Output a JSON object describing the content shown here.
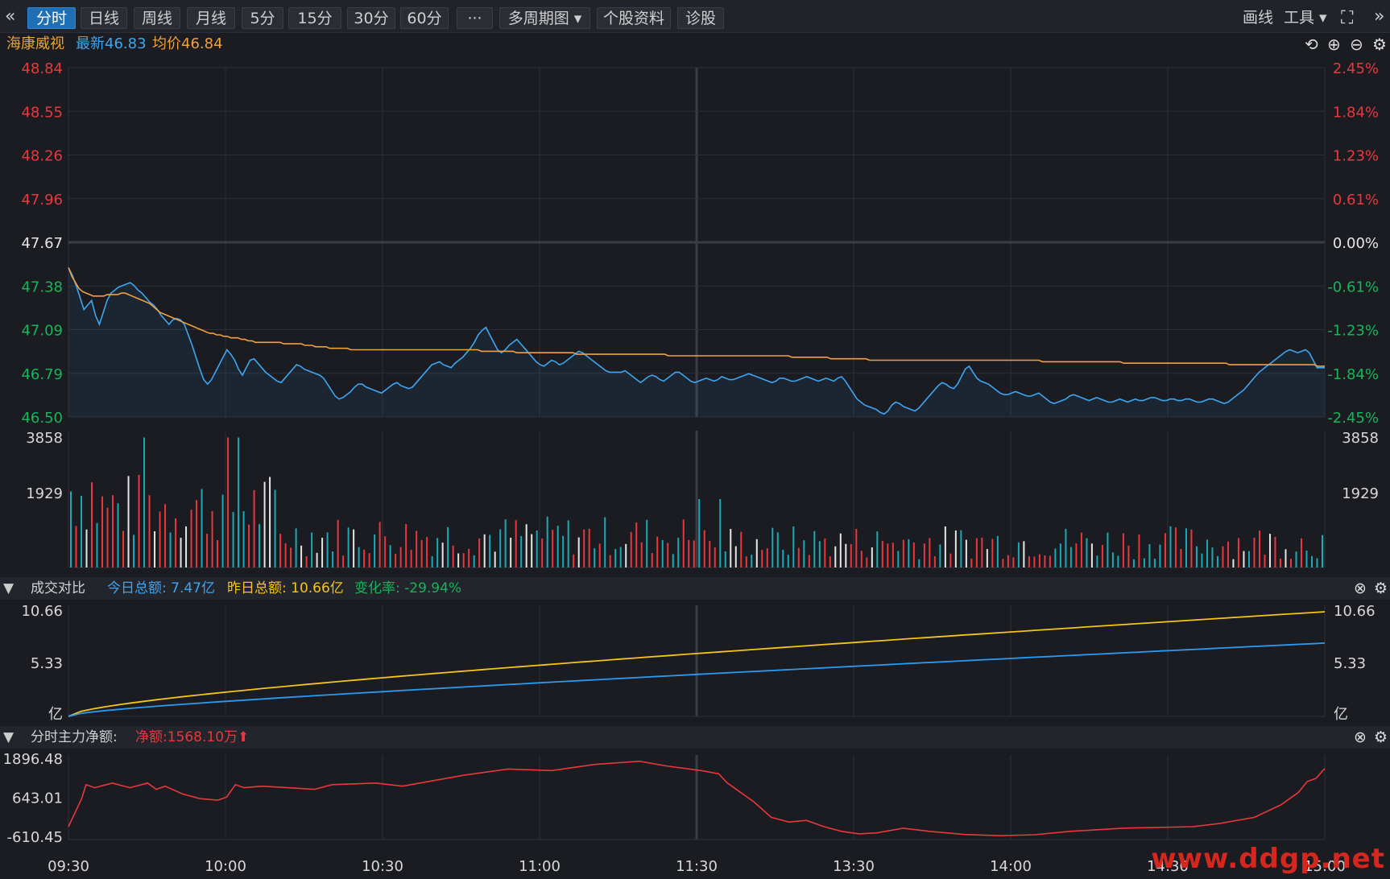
{
  "toolbar": {
    "collapse_icon": "«",
    "tabs": [
      "分时",
      "日线",
      "周线",
      "月线",
      "5分",
      "15分",
      "30分",
      "60分",
      "···",
      "多周期图 ▾",
      "个股资料",
      "诊股"
    ],
    "active_tab": 0,
    "draw_label": "画线",
    "tools_label": "工具 ▾",
    "fullscreen_icon": "⛶",
    "expand_icon": "»"
  },
  "stock": {
    "name": "海康威视",
    "latest_label": "最新46.83",
    "avg_label": "均价46.84"
  },
  "colors": {
    "up": "#e8383d",
    "down": "#17b558",
    "price_line": "#3ea6f0",
    "avg_line": "#f0a040",
    "yesterday_line": "#f5c518",
    "today_line": "#2a9af0",
    "net_line": "#e8383d",
    "grid": "#2c2f37",
    "volume_up": "#e8383d",
    "volume_down": "#1aa9b5",
    "volume_flat": "#e6e6e6"
  },
  "turnover_panel": {
    "title": "成交对比",
    "today_total": "今日总额: 7.47亿",
    "yesterday_total": "昨日总额: 10.66亿",
    "change_rate": "变化率: -29.94%"
  },
  "netflow_panel": {
    "title": "分时主力净额:",
    "net_amount": "净额:1568.10万⬆"
  },
  "watermark": "www.ddgp.net",
  "chart_data": [
    {
      "type": "line",
      "name": "price",
      "x_ticks": [
        "09:30",
        "10:00",
        "10:30",
        "11:00",
        "11:30",
        "13:30",
        "14:00",
        "14:30",
        "15:00"
      ],
      "ylim": [
        46.5,
        48.84
      ],
      "y_ticks_left": [
        "48.84",
        "48.55",
        "48.26",
        "47.96",
        "47.67",
        "47.38",
        "47.09",
        "46.79",
        "46.50"
      ],
      "y_ticks_right": [
        "2.45%",
        "1.84%",
        "1.23%",
        "0.61%",
        "0.00%",
        "-0.61%",
        "-1.23%",
        "-1.84%",
        "-2.45%"
      ],
      "base": 47.67,
      "price": [
        47.5,
        47.45,
        47.38,
        47.3,
        47.22,
        47.25,
        47.28,
        47.18,
        47.12,
        47.2,
        47.28,
        47.33,
        47.35,
        47.37,
        47.38,
        47.39,
        47.4,
        47.38,
        47.35,
        47.33,
        47.3,
        47.27,
        47.25,
        47.22,
        47.18,
        47.15,
        47.12,
        47.15,
        47.16,
        47.15,
        47.12,
        47.05,
        46.98,
        46.9,
        46.82,
        46.75,
        46.72,
        46.75,
        46.8,
        46.85,
        46.9,
        46.95,
        46.92,
        46.88,
        46.82,
        46.78,
        46.83,
        46.88,
        46.89,
        46.86,
        46.83,
        46.8,
        46.78,
        46.76,
        46.74,
        46.73,
        46.76,
        46.79,
        46.82,
        46.85,
        46.84,
        46.82,
        46.81,
        46.8,
        46.79,
        46.78,
        46.76,
        46.72,
        46.68,
        46.64,
        46.62,
        46.63,
        46.65,
        46.67,
        46.7,
        46.72,
        46.72,
        46.7,
        46.69,
        46.68,
        46.67,
        46.66,
        46.68,
        46.7,
        46.72,
        46.73,
        46.71,
        46.7,
        46.69,
        46.7,
        46.73,
        46.76,
        46.79,
        46.82,
        46.85,
        46.86,
        46.87,
        46.85,
        46.84,
        46.83,
        46.86,
        46.88,
        46.9,
        46.93,
        46.96,
        47.0,
        47.05,
        47.08,
        47.1,
        47.05,
        47.0,
        46.95,
        46.93,
        46.95,
        46.98,
        47.0,
        47.02,
        46.99,
        46.96,
        46.93,
        46.9,
        46.87,
        46.85,
        46.84,
        46.86,
        46.88,
        46.87,
        46.85,
        46.86,
        46.88,
        46.9,
        46.92,
        46.94,
        46.93,
        46.91,
        46.89,
        46.87,
        46.85,
        46.83,
        46.81,
        46.8,
        46.8,
        46.8,
        46.8,
        46.81,
        46.79,
        46.77,
        46.75,
        46.73,
        46.75,
        46.77,
        46.78,
        46.77,
        46.75,
        46.74,
        46.76,
        46.78,
        46.8,
        46.8,
        46.78,
        46.76,
        46.74,
        46.73,
        46.74,
        46.75,
        46.76,
        46.75,
        46.74,
        46.75,
        46.77,
        46.76,
        46.75,
        46.75,
        46.76,
        46.77,
        46.78,
        46.79,
        46.78,
        46.77,
        46.76,
        46.75,
        46.74,
        46.73,
        46.74,
        46.76,
        46.76,
        46.75,
        46.74,
        46.74,
        46.75,
        46.76,
        46.77,
        46.76,
        46.75,
        46.74,
        46.75,
        46.76,
        46.75,
        46.74,
        46.76,
        46.77,
        46.74,
        46.7,
        46.66,
        46.62,
        46.6,
        46.58,
        46.57,
        46.56,
        46.55,
        46.53,
        46.52,
        46.54,
        46.58,
        46.6,
        46.59,
        46.57,
        46.56,
        46.55,
        46.54,
        46.56,
        46.59,
        46.62,
        46.65,
        46.68,
        46.71,
        46.73,
        46.72,
        46.7,
        46.69,
        46.72,
        46.77,
        46.82,
        46.84,
        46.8,
        46.76,
        46.74,
        46.73,
        46.72,
        46.7,
        46.68,
        46.66,
        46.65,
        46.65,
        46.66,
        46.67,
        46.66,
        46.65,
        46.64,
        46.64,
        46.65,
        46.66,
        46.64,
        46.62,
        46.6,
        46.59,
        46.6,
        46.61,
        46.62,
        46.64,
        46.65,
        46.64,
        46.63,
        46.62,
        46.61,
        46.62,
        46.63,
        46.62,
        46.61,
        46.6,
        46.6,
        46.61,
        46.62,
        46.61,
        46.6,
        46.61,
        46.62,
        46.61,
        46.61,
        46.62,
        46.63,
        46.63,
        46.62,
        46.61,
        46.61,
        46.62,
        46.62,
        46.61,
        46.61,
        46.62,
        46.62,
        46.61,
        46.6,
        46.6,
        46.61,
        46.62,
        46.62,
        46.61,
        46.6,
        46.59,
        46.6,
        46.62,
        46.64,
        46.66,
        46.68,
        46.71,
        46.74,
        46.77,
        46.8,
        46.82,
        46.84,
        46.86,
        46.88,
        46.9,
        46.92,
        46.94,
        46.95,
        46.94,
        46.93,
        46.94,
        46.95,
        46.93,
        46.88,
        46.83,
        46.83,
        46.83
      ],
      "avg": [
        47.5,
        47.44,
        47.4,
        47.36,
        47.34,
        47.33,
        47.32,
        47.31,
        47.31,
        47.31,
        47.31,
        47.32,
        47.32,
        47.32,
        47.32,
        47.33,
        47.33,
        47.32,
        47.31,
        47.3,
        47.29,
        47.28,
        47.27,
        47.26,
        47.24,
        47.22,
        47.2,
        47.19,
        47.18,
        47.17,
        47.16,
        47.15,
        47.14,
        47.13,
        47.12,
        47.11,
        47.1,
        47.09,
        47.08,
        47.07,
        47.06,
        47.06,
        47.05,
        47.05,
        47.04,
        47.04,
        47.03,
        47.03,
        47.03,
        47.02,
        47.02,
        47.01,
        47.01,
        47.0,
        47.0,
        47.0,
        47.0,
        47.0,
        47.0,
        47.0,
        47.0,
        46.99,
        46.99,
        46.99,
        46.99,
        46.99,
        46.99,
        46.98,
        46.98,
        46.98,
        46.97,
        46.97,
        46.97,
        46.97,
        46.96,
        46.96,
        46.96,
        46.96,
        46.96,
        46.96,
        46.95,
        46.95,
        46.95,
        46.95,
        46.95,
        46.95,
        46.95,
        46.95,
        46.95,
        46.95,
        46.95,
        46.95,
        46.95,
        46.95,
        46.95,
        46.95,
        46.95,
        46.95,
        46.95,
        46.95,
        46.95,
        46.95,
        46.95,
        46.95,
        46.95,
        46.95,
        46.95,
        46.95,
        46.95,
        46.95,
        46.95,
        46.95,
        46.95,
        46.95,
        46.95,
        46.95,
        46.95,
        46.94,
        46.94,
        46.94,
        46.94,
        46.94,
        46.94,
        46.94,
        46.94,
        46.94,
        46.94,
        46.93,
        46.93,
        46.93,
        46.93,
        46.93,
        46.93,
        46.93,
        46.93,
        46.93,
        46.93,
        46.93,
        46.93,
        46.93,
        46.93,
        46.93,
        46.93,
        46.93,
        46.92,
        46.92,
        46.92,
        46.92,
        46.92,
        46.92,
        46.92,
        46.92,
        46.92,
        46.92,
        46.92,
        46.92,
        46.92,
        46.92,
        46.92,
        46.92,
        46.92,
        46.92,
        46.92,
        46.92,
        46.92,
        46.92,
        46.92,
        46.92,
        46.92,
        46.92,
        46.91,
        46.91,
        46.91,
        46.91,
        46.91,
        46.91,
        46.91,
        46.91,
        46.91,
        46.91,
        46.91,
        46.91,
        46.91,
        46.91,
        46.91,
        46.91,
        46.91,
        46.91,
        46.91,
        46.91,
        46.91,
        46.91,
        46.91,
        46.91,
        46.91,
        46.91,
        46.91,
        46.91,
        46.91,
        46.91,
        46.91,
        46.91,
        46.91,
        46.91,
        46.91,
        46.9,
        46.9,
        46.9,
        46.9,
        46.9,
        46.9,
        46.9,
        46.9,
        46.9,
        46.9,
        46.9,
        46.89,
        46.89,
        46.89,
        46.89,
        46.89,
        46.89,
        46.89,
        46.89,
        46.89,
        46.89,
        46.89,
        46.88,
        46.88,
        46.88,
        46.88,
        46.88,
        46.88,
        46.88,
        46.88,
        46.88,
        46.88,
        46.88,
        46.88,
        46.88,
        46.88,
        46.88,
        46.88,
        46.88,
        46.88,
        46.88,
        46.88,
        46.88,
        46.88,
        46.88,
        46.88,
        46.88,
        46.88,
        46.88,
        46.88,
        46.88,
        46.88,
        46.88,
        46.88,
        46.88,
        46.88,
        46.88,
        46.88,
        46.88,
        46.88,
        46.88,
        46.88,
        46.88,
        46.88,
        46.88,
        46.88,
        46.88,
        46.88,
        46.88,
        46.88,
        46.88,
        46.87,
        46.87,
        46.87,
        46.87,
        46.87,
        46.87,
        46.87,
        46.87,
        46.87,
        46.87,
        46.87,
        46.87,
        46.87,
        46.87,
        46.87,
        46.87,
        46.87,
        46.87,
        46.87,
        46.87,
        46.87,
        46.87,
        46.87,
        46.86,
        46.86,
        46.86,
        46.86,
        46.86,
        46.86,
        46.86,
        46.86,
        46.86,
        46.86,
        46.86,
        46.86,
        46.86,
        46.86,
        46.86,
        46.86,
        46.86,
        46.86,
        46.86,
        46.86,
        46.86,
        46.86,
        46.86,
        46.86,
        46.86,
        46.86,
        46.86,
        46.86,
        46.86,
        46.86,
        46.85,
        46.85,
        46.85,
        46.85,
        46.85,
        46.85,
        46.85,
        46.85,
        46.85,
        46.85,
        46.85,
        46.85,
        46.85,
        46.85,
        46.85,
        46.85,
        46.85,
        46.85,
        46.85,
        46.85,
        46.85,
        46.85,
        46.85,
        46.85,
        46.85,
        46.84,
        46.84,
        46.84
      ]
    },
    {
      "type": "bar",
      "name": "volume",
      "y_ticks": [
        "3858",
        "1929"
      ],
      "ylim": [
        0,
        3858
      ]
    },
    {
      "type": "line",
      "name": "turnover_compare",
      "ylim": [
        0,
        10.66
      ],
      "y_ticks": [
        "10.66",
        "5.33",
        "亿"
      ],
      "series": [
        {
          "name": "昨日总额",
          "final": 10.66
        },
        {
          "name": "今日总额",
          "final": 7.47
        }
      ]
    },
    {
      "type": "line",
      "name": "main_net_flow",
      "ylim": [
        -610.45,
        1896.48
      ],
      "y_ticks": [
        "1896.48",
        "643.01",
        "-610.45"
      ]
    }
  ]
}
